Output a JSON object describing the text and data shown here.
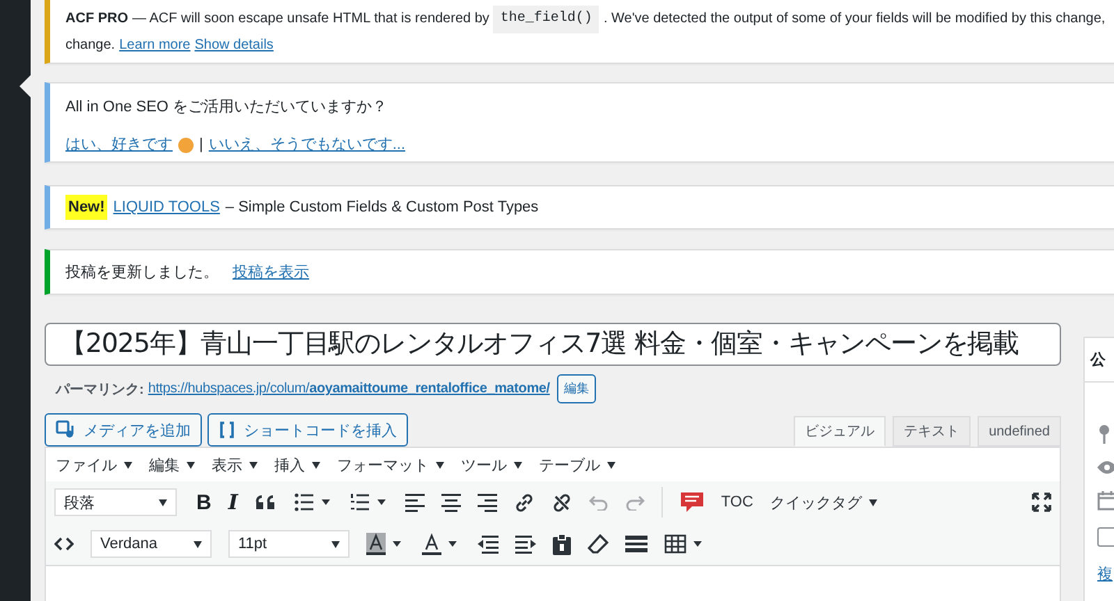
{
  "notices": [
    {
      "kind": "acf",
      "color": "#dba617",
      "brand": "ACF PRO",
      "text_before": "— ACF will soon escape unsafe HTML that is rendered by",
      "code": "the_field()",
      "text_after": ". We've detected the output of some of your fields will be modified by this change,",
      "line_2": "change.",
      "links": [
        "Learn more",
        "Show details"
      ]
    },
    {
      "kind": "seo",
      "color": "#72aee6",
      "question": "All in One SEO をご活用いただいていますか？",
      "yes": "はい、好きです",
      "separator": "|",
      "no": "いいえ、そうでもないです..."
    },
    {
      "kind": "promo",
      "color": "#72aee6",
      "badge": "New!",
      "link": "LIQUID TOOLS",
      "text": "– Simple Custom Fields & Custom Post Types"
    },
    {
      "kind": "success",
      "color": "#00a32a",
      "text": "投稿を更新しました。",
      "link": "投稿を表示"
    }
  ],
  "post_title": "【2025年】青山一丁目駅のレンタルオフィス7選 料金・個室・キャンペーンを掲載",
  "permalink": {
    "label": "パーマリンク:",
    "base": "https://hubspaces.jp/colum/",
    "slug": "aoyamaittoume_rentaloffice_matome/",
    "edit": "編集"
  },
  "media_buttons": [
    "メディアを追加",
    "ショートコードを挿入"
  ],
  "editor_tabs": [
    {
      "label": "ビジュアル",
      "selected": true
    },
    {
      "label": "テキスト",
      "selected": false
    },
    {
      "label": "undefined",
      "selected": false
    }
  ],
  "menubar": [
    "ファイル",
    "編集",
    "表示",
    "挿入",
    "フォーマット",
    "ツール",
    "テーブル"
  ],
  "toolbar": {
    "format": "段落",
    "bold": "B",
    "italic": "I",
    "toc": "TOC",
    "quicktags": "クイックタグ",
    "font": "Verdana",
    "size": "11pt"
  },
  "side_panel": {
    "title": "公",
    "link": "複",
    "checked": false
  }
}
